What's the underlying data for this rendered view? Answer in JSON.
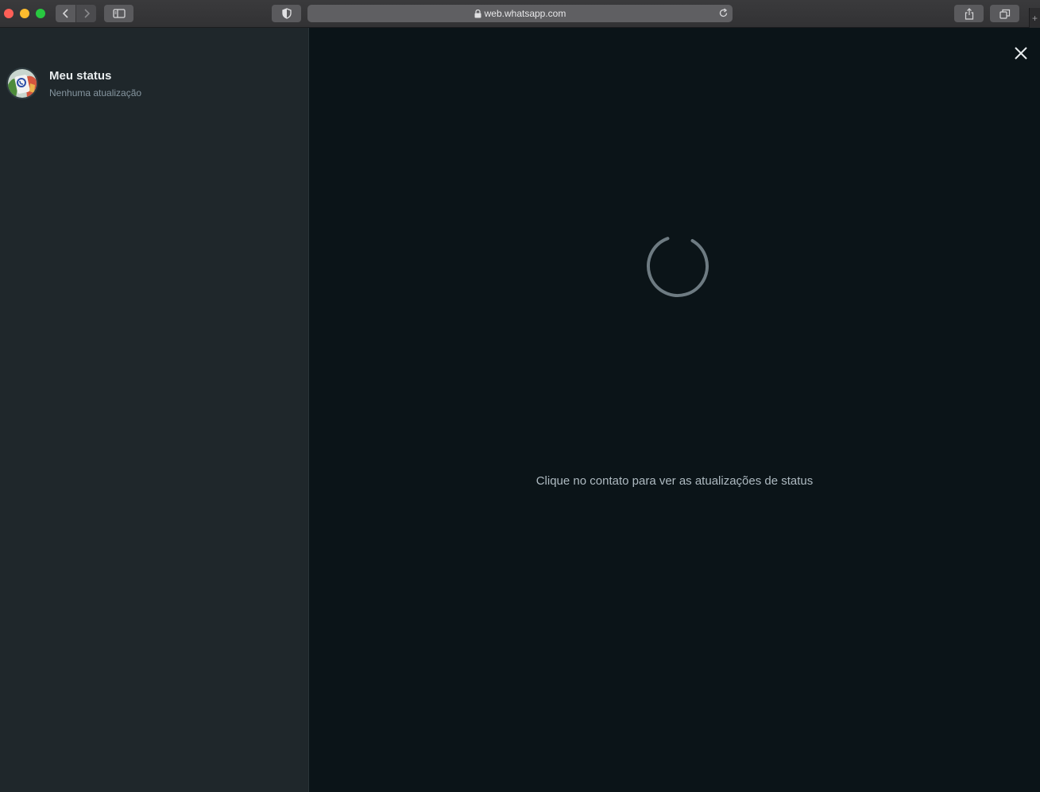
{
  "browser": {
    "url": "web.whatsapp.com",
    "icons": {
      "back": "chevron-left-icon",
      "forward": "chevron-right-icon",
      "sidebar": "sidebar-icon",
      "privacy": "shield-icon",
      "lock": "lock-icon",
      "reload": "reload-icon",
      "share": "share-icon",
      "tabs": "tabs-icon",
      "new_tab": "plus-icon"
    }
  },
  "sidebar": {
    "my_status": {
      "name": "Meu status",
      "subtitle": "Nenhuma atualização"
    }
  },
  "main": {
    "hint": "Clique no contato para ver as atualizações de status",
    "close_icon": "close-icon",
    "loading_icon": "spinner-icon"
  },
  "colors": {
    "sidebar_bg": "#1f272b",
    "main_bg": "#0b1418",
    "primary_text": "#e9edef",
    "secondary_text": "#8696a0",
    "hint_text": "#aebac1"
  }
}
